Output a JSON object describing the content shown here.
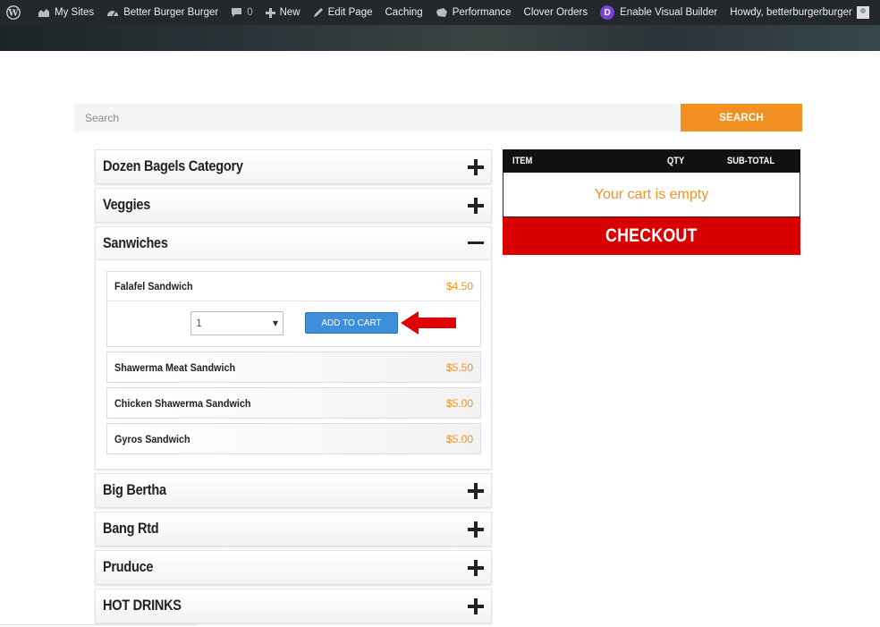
{
  "adminbar": {
    "my_sites": "My Sites",
    "site_name": "Better Burger Burger",
    "comments_count": "0",
    "new_label": "New",
    "edit_page": "Edit Page",
    "caching": "Caching",
    "performance": "Performance",
    "clover_orders": "Clover Orders",
    "divi_letter": "D",
    "visual_builder": "Enable Visual Builder",
    "howdy": "Howdy, betterburgerburger"
  },
  "search": {
    "placeholder": "Search",
    "button_label": "SEARCH"
  },
  "categories": [
    {
      "title": "Dozen Bagels Category",
      "state": "collapsed"
    },
    {
      "title": "Veggies",
      "state": "collapsed"
    },
    {
      "title": "Sanwiches",
      "state": "expanded"
    },
    {
      "title": "Big Bertha",
      "state": "collapsed"
    },
    {
      "title": "Bang Rtd",
      "state": "collapsed"
    },
    {
      "title": "Pruduce",
      "state": "collapsed"
    },
    {
      "title": "HOT DRINKS",
      "state": "collapsed"
    }
  ],
  "items": [
    {
      "name": "Falafel Sandwich",
      "price": "$4.50"
    },
    {
      "name": "Shawerma Meat Sandwich",
      "price": "$5.50"
    },
    {
      "name": "Chicken Shawerma Sandwich",
      "price": "$5.00"
    },
    {
      "name": "Gyros Sandwich",
      "price": "$5.00"
    }
  ],
  "add_to_cart": {
    "quantity": "1",
    "button_label": "ADD TO CART"
  },
  "cart": {
    "col_item": "ITEM",
    "col_qty": "QTY",
    "col_subtotal": "SUB-TOTAL",
    "empty_text": "Your cart is empty",
    "checkout_label": "CHECKOUT"
  },
  "colors": {
    "accent_orange": "#f29121",
    "checkout_red": "#d80000",
    "admin_bar": "#23282d",
    "add_button_blue": "#3d8fdb"
  }
}
